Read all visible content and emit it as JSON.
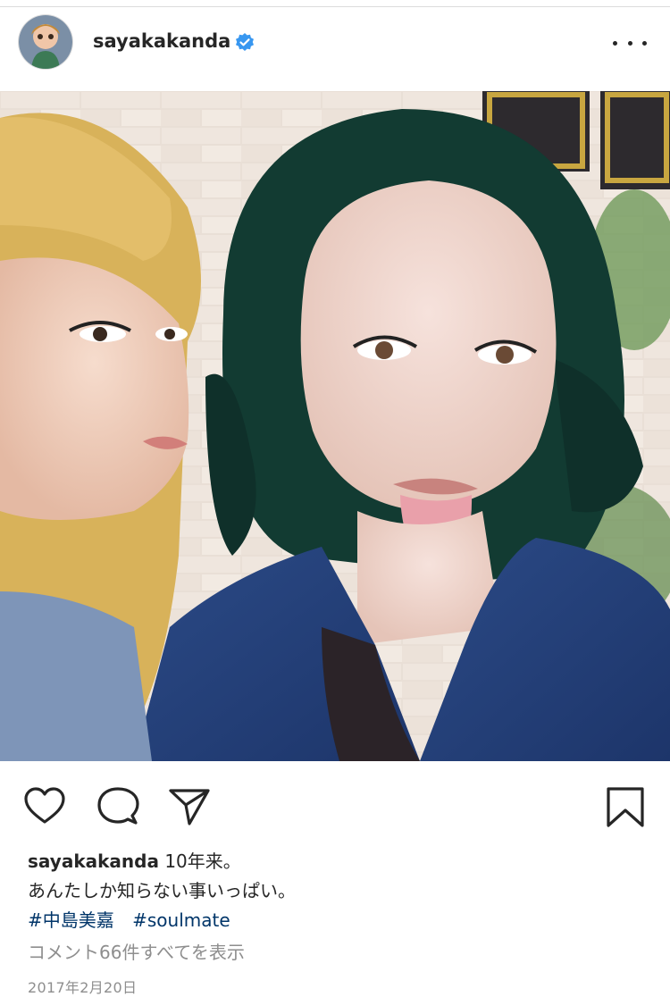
{
  "post": {
    "username": "sayakakanda",
    "verified_icon": "verified-badge-icon",
    "more_icon": "ellipsis-icon",
    "photo_alt": "",
    "actions": {
      "like_icon": "heart-icon",
      "comment_icon": "comment-bubble-icon",
      "share_icon": "paper-plane-icon",
      "save_icon": "bookmark-icon"
    },
    "caption": {
      "username": "sayakakanda",
      "line1": "10年来。",
      "line2": "あんたしか知らない事いっぱい。",
      "tags": [
        "#中島美嘉",
        "#soulmate"
      ]
    },
    "comments_link": "コメント66件すべてを表示",
    "date": "2017年2月20日"
  },
  "colors": {
    "text": "#262626",
    "link": "#003569",
    "muted": "#8e8e8e",
    "verified": "#3897f0"
  }
}
